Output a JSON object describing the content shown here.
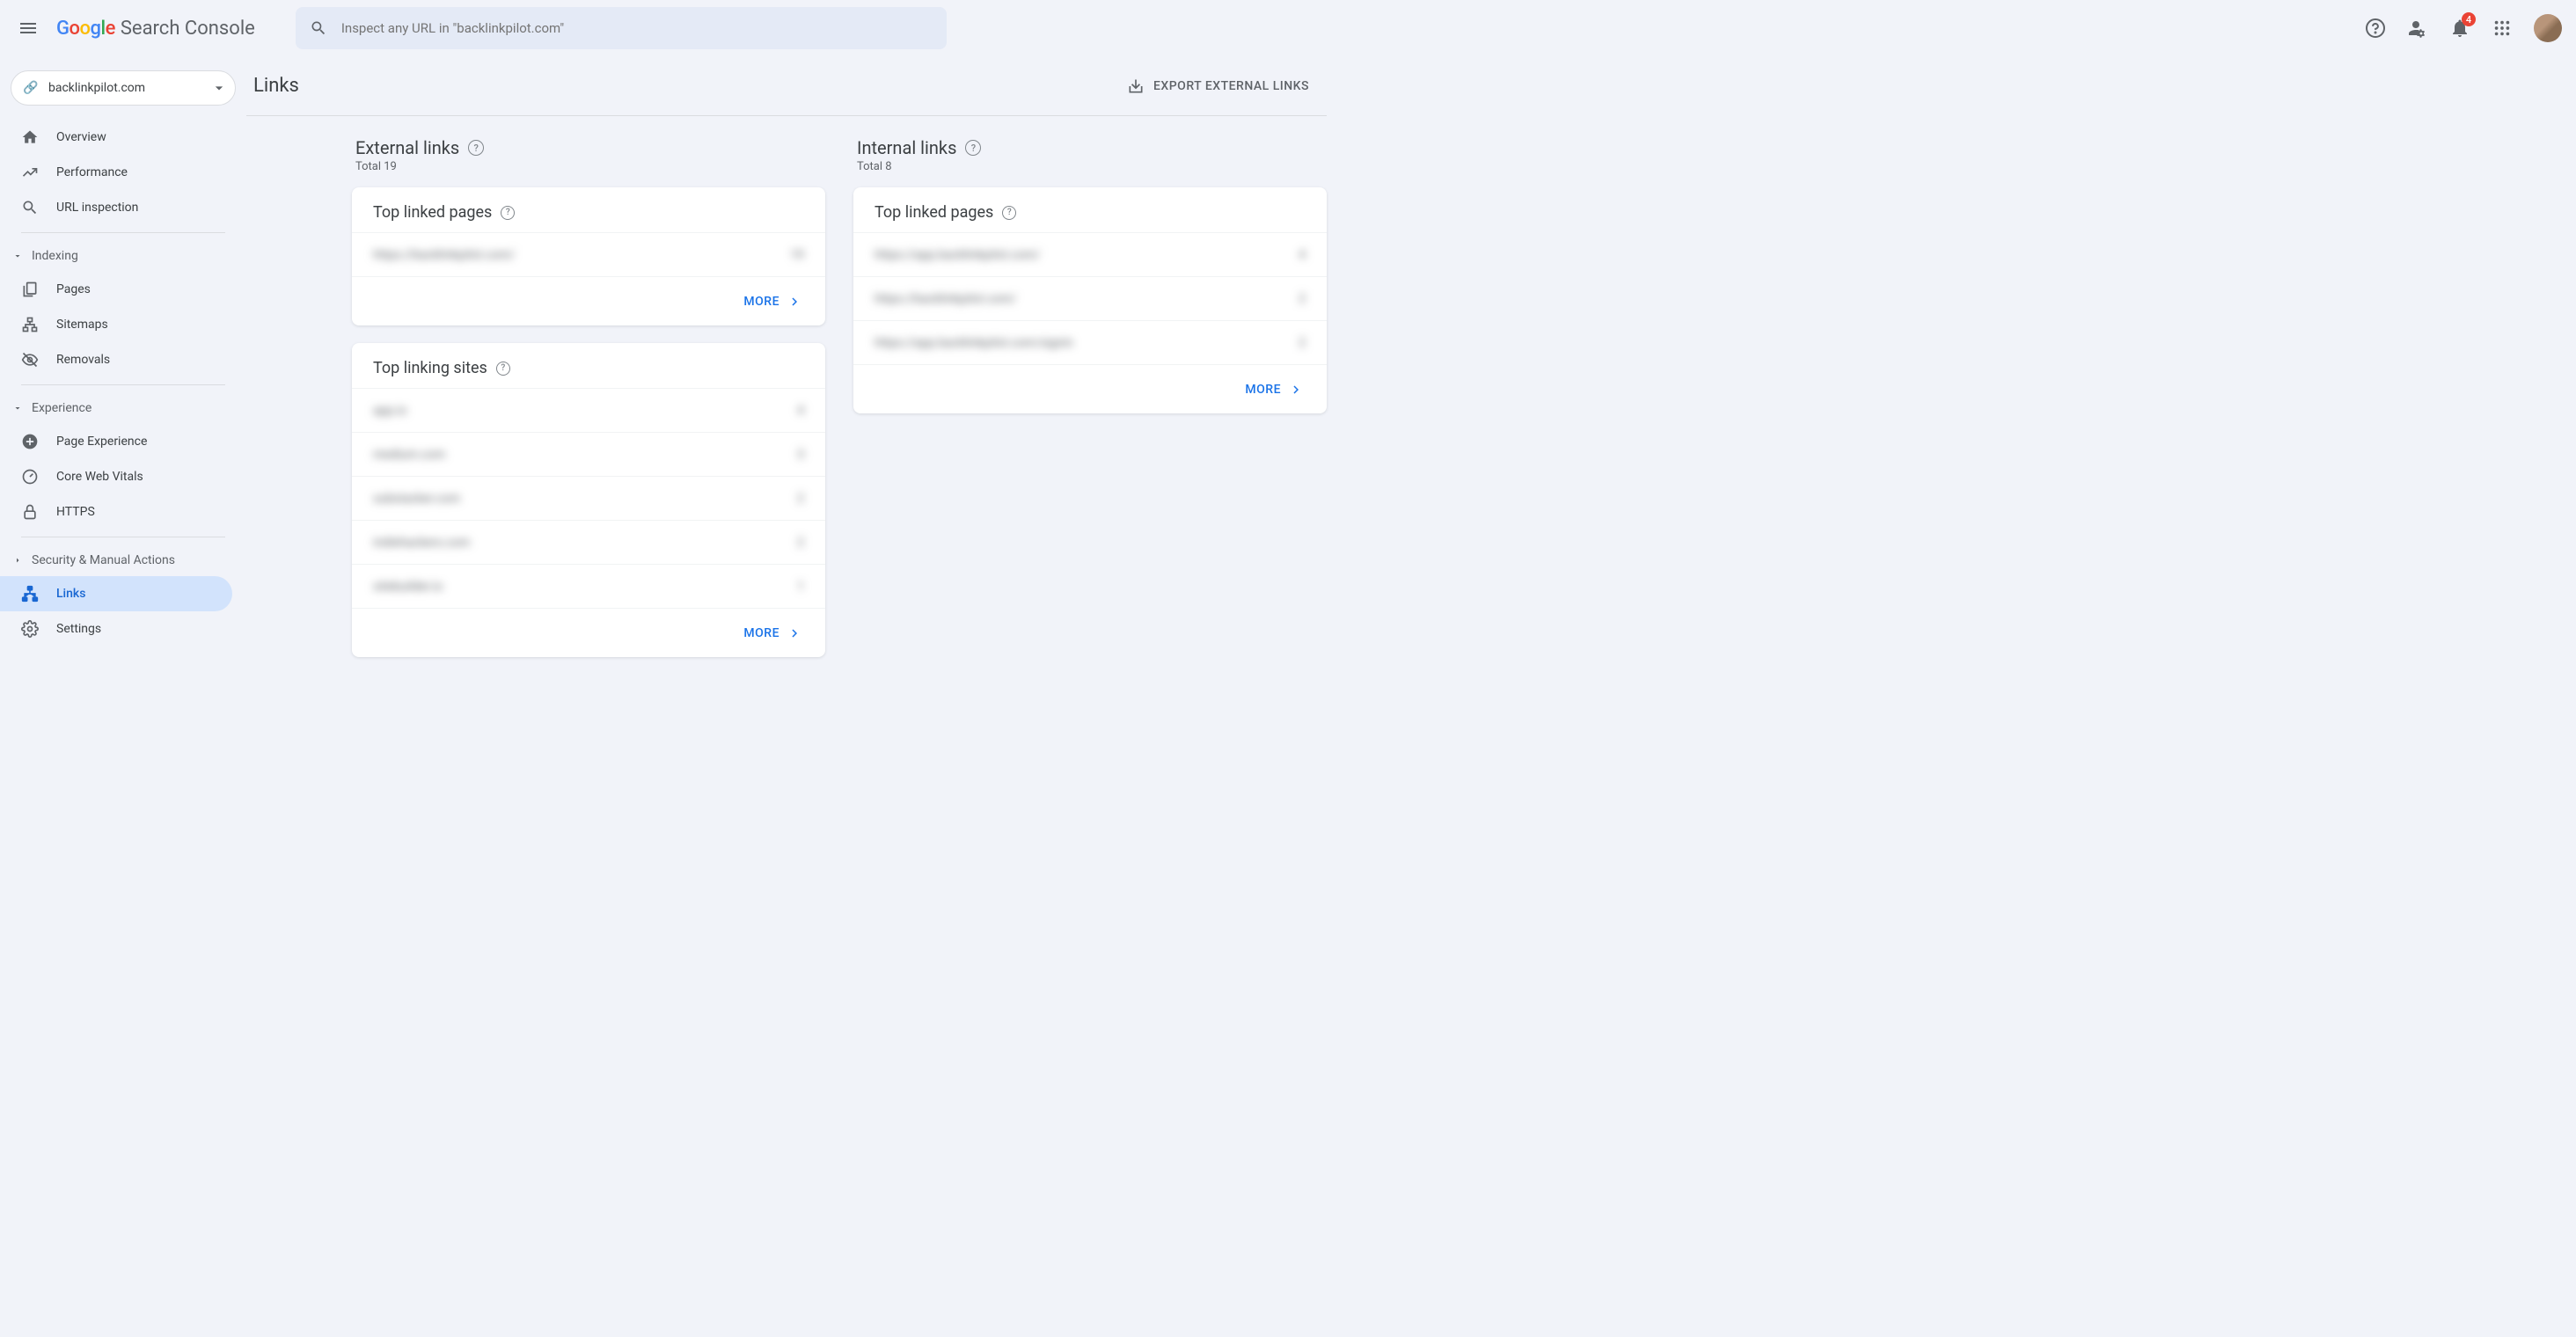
{
  "header": {
    "product_name": "Search Console",
    "search_placeholder": "Inspect any URL in \"backlinkpilot.com\"",
    "notification_count": "4"
  },
  "sidebar": {
    "property": "backlinkpilot.com",
    "items": {
      "overview": "Overview",
      "performance": "Performance",
      "url_inspection": "URL inspection",
      "indexing": "Indexing",
      "pages": "Pages",
      "sitemaps": "Sitemaps",
      "removals": "Removals",
      "experience": "Experience",
      "page_experience": "Page Experience",
      "cwv": "Core Web Vitals",
      "https": "HTTPS",
      "security": "Security & Manual Actions",
      "links": "Links",
      "settings": "Settings"
    }
  },
  "page": {
    "title": "Links",
    "export_label": "EXPORT EXTERNAL LINKS",
    "more_label": "MORE"
  },
  "external": {
    "title": "External links",
    "total_label": "Total 19",
    "cards": {
      "top_linked": {
        "title": "Top linked pages",
        "rows": [
          {
            "url": "https://backlinkpilot.com/",
            "count": "19"
          }
        ]
      },
      "top_sites": {
        "title": "Top linking sites",
        "rows": [
          {
            "url": "app.io",
            "count": "4"
          },
          {
            "url": "medium.com",
            "count": "3"
          },
          {
            "url": "substacker.com",
            "count": "2"
          },
          {
            "url": "indiehackers.com",
            "count": "2"
          },
          {
            "url": "sitebuilder.io",
            "count": "1"
          }
        ]
      }
    }
  },
  "internal": {
    "title": "Internal links",
    "total_label": "Total 8",
    "cards": {
      "top_linked": {
        "title": "Top linked pages",
        "rows": [
          {
            "url": "https://app.backlinkpilot.com/",
            "count": "4"
          },
          {
            "url": "https://backlinkpilot.com/",
            "count": "2"
          },
          {
            "url": "https://app.backlinkpilot.com/signin",
            "count": "2"
          }
        ]
      }
    }
  }
}
